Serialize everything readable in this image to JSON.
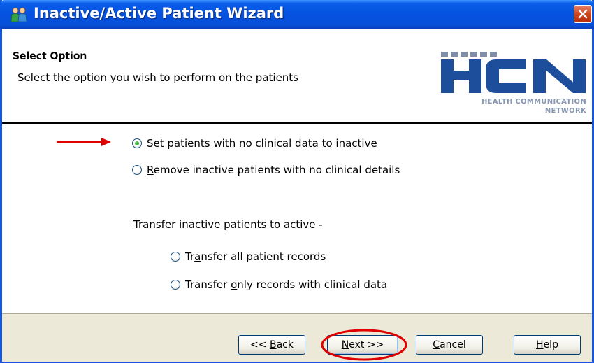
{
  "window": {
    "title": "Inactive/Active Patient Wizard"
  },
  "header": {
    "title": "Select Option",
    "subtitle": "Select the option you wish to perform on the patients",
    "logo": {
      "letters": "HCN",
      "line1": "HEALTH COMMUNICATION",
      "line2": "NETWORK",
      "color": "#1c4e9c"
    }
  },
  "options": [
    {
      "label": "Set patients with no clinical data to inactive",
      "accel": "S",
      "checked": true
    },
    {
      "label": "Remove inactive patients with no clinical details",
      "accel": "R",
      "checked": false
    }
  ],
  "transfer": {
    "label": "Transfer inactive patients to active -",
    "accel": "T",
    "options": [
      {
        "label": "Transfer all patient records",
        "accel": "a",
        "checked": false
      },
      {
        "label": "Transfer only records with clinical data",
        "accel": "o",
        "checked": false
      }
    ]
  },
  "buttons": {
    "back": "<< Back",
    "next": "Next >>",
    "cancel": "Cancel",
    "help": "Help"
  },
  "annotation_color": "#e00000"
}
